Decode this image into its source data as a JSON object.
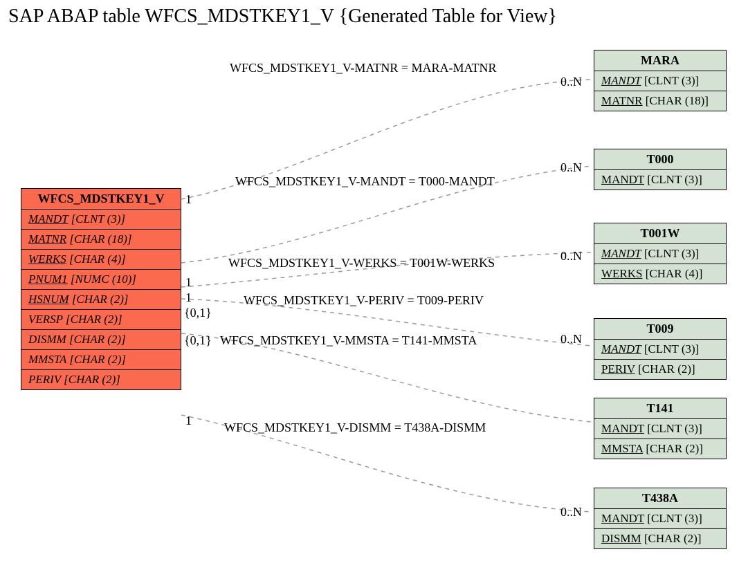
{
  "title": "SAP ABAP table WFCS_MDSTKEY1_V {Generated Table for View}",
  "main": {
    "name": "WFCS_MDSTKEY1_V",
    "fields": [
      {
        "name": "MANDT",
        "type": "[CLNT (3)]",
        "u": true
      },
      {
        "name": "MATNR",
        "type": "[CHAR (18)]",
        "u": true
      },
      {
        "name": "WERKS",
        "type": "[CHAR (4)]",
        "u": true
      },
      {
        "name": "PNUM1",
        "type": "[NUMC (10)]",
        "u": true
      },
      {
        "name": "HSNUM",
        "type": "[CHAR (2)]",
        "u": true
      },
      {
        "name": "VERSP",
        "type": "[CHAR (2)]",
        "u": false
      },
      {
        "name": "DISMM",
        "type": "[CHAR (2)]",
        "u": false
      },
      {
        "name": "MMSTA",
        "type": "[CHAR (2)]",
        "u": false
      },
      {
        "name": "PERIV",
        "type": "[CHAR (2)]",
        "u": false
      }
    ]
  },
  "relations": [
    {
      "table": "MARA",
      "label": "WFCS_MDSTKEY1_V-MATNR = MARA-MATNR",
      "leftCard": "1",
      "rightCard": "0..N",
      "mandtItalic": true,
      "fields": [
        {
          "name": "MANDT",
          "type": "[CLNT (3)]",
          "cls": "mandt"
        },
        {
          "name": "MATNR",
          "type": "[CHAR (18)]"
        }
      ]
    },
    {
      "table": "T000",
      "label": "WFCS_MDSTKEY1_V-MANDT = T000-MANDT",
      "leftCard": "",
      "rightCard": "0..N",
      "mandtItalic": false,
      "fields": [
        {
          "name": "MANDT",
          "type": "[CLNT (3)]",
          "cls": "mandt"
        }
      ]
    },
    {
      "table": "T001W",
      "label": "WFCS_MDSTKEY1_V-WERKS = T001W-WERKS",
      "leftCard": "1",
      "rightCard": "0..N",
      "mandtItalic": true,
      "fields": [
        {
          "name": "MANDT",
          "type": "[CLNT (3)]",
          "cls": "mandt"
        },
        {
          "name": "WERKS",
          "type": "[CHAR (4)]"
        }
      ]
    },
    {
      "table": "T009",
      "label": "WFCS_MDSTKEY1_V-PERIV = T009-PERIV",
      "leftCard": "1",
      "rightCard": "0..N",
      "mandtItalic": true,
      "fields": [
        {
          "name": "MANDT",
          "type": "[CLNT (3)]",
          "cls": "mandt"
        },
        {
          "name": "PERIV",
          "type": "[CHAR (2)]"
        }
      ]
    },
    {
      "table": "T141",
      "label": "WFCS_MDSTKEY1_V-MMSTA = T141-MMSTA",
      "leftCard": "{0,1}",
      "rightCard": "",
      "mandtItalic": false,
      "fields": [
        {
          "name": "MANDT",
          "type": "[CLNT (3)]",
          "cls": "mandt"
        },
        {
          "name": "MMSTA",
          "type": "[CHAR (2)]"
        }
      ]
    },
    {
      "table": "T438A",
      "label": "WFCS_MDSTKEY1_V-DISMM = T438A-DISMM",
      "leftCard": "{0,1}",
      "rightCard": "0..N",
      "mandtItalic": false,
      "fields": [
        {
          "name": "MANDT",
          "type": "[CLNT (3)]",
          "cls": "mandt"
        },
        {
          "name": "DISMM",
          "type": "[CHAR (2)]"
        }
      ]
    }
  ],
  "extraLeftCard": "1"
}
